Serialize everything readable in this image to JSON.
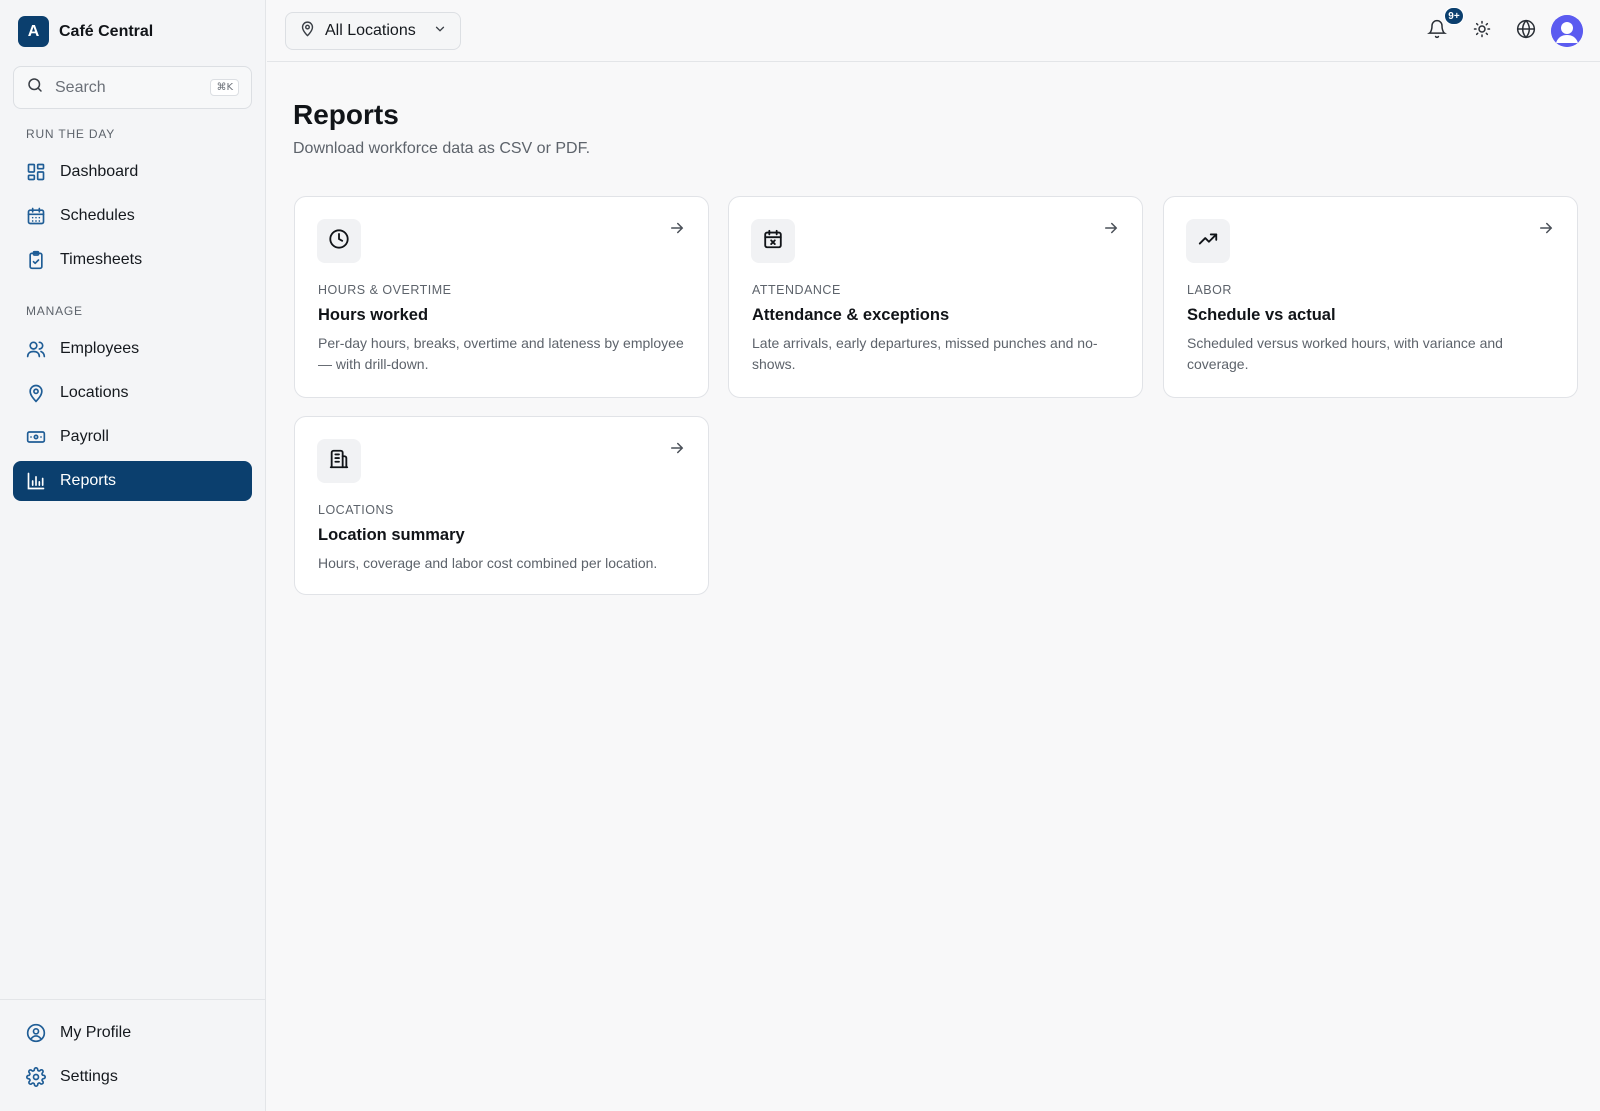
{
  "brand": {
    "logo_letter": "A",
    "name": "Café Central"
  },
  "search": {
    "placeholder": "Search",
    "shortcut": "⌘K"
  },
  "sidebar": {
    "sections": [
      {
        "label": "RUN THE DAY"
      },
      {
        "label": "MANAGE"
      }
    ],
    "items": [
      {
        "label": "Dashboard",
        "icon": "dashboard-icon"
      },
      {
        "label": "Schedules",
        "icon": "calendar-icon"
      },
      {
        "label": "Timesheets",
        "icon": "clipboard-check-icon"
      },
      {
        "label": "Employees",
        "icon": "users-icon"
      },
      {
        "label": "Locations",
        "icon": "map-pin-icon"
      },
      {
        "label": "Payroll",
        "icon": "banknote-icon"
      },
      {
        "label": "Reports",
        "icon": "bar-chart-icon",
        "active": true
      }
    ],
    "footer": [
      {
        "label": "My Profile",
        "icon": "user-circle-icon"
      },
      {
        "label": "Settings",
        "icon": "gear-icon"
      }
    ]
  },
  "topbar": {
    "location_select": "All Locations",
    "notification_count": "9+"
  },
  "page": {
    "title": "Reports",
    "subtitle": "Download workforce data as CSV or PDF."
  },
  "cards": [
    {
      "eyebrow": "HOURS & OVERTIME",
      "title": "Hours worked",
      "description": "Per-day hours, breaks, overtime and lateness by employee — with drill-down.",
      "icon": "clock-icon"
    },
    {
      "eyebrow": "ATTENDANCE",
      "title": "Attendance & exceptions",
      "description": "Late arrivals, early departures, missed punches and no-shows.",
      "icon": "calendar-x-icon"
    },
    {
      "eyebrow": "LABOR",
      "title": "Schedule vs actual",
      "description": "Scheduled versus worked hours, with variance and coverage.",
      "icon": "trending-up-icon"
    },
    {
      "eyebrow": "LOCATIONS",
      "title": "Location summary",
      "description": "Hours, coverage and labor cost combined per location.",
      "icon": "building-icon"
    }
  ],
  "colors": {
    "accent": "#0b3f6e",
    "sidebar_icon": "#1f5d96",
    "avatar": "#5b5bf0"
  }
}
